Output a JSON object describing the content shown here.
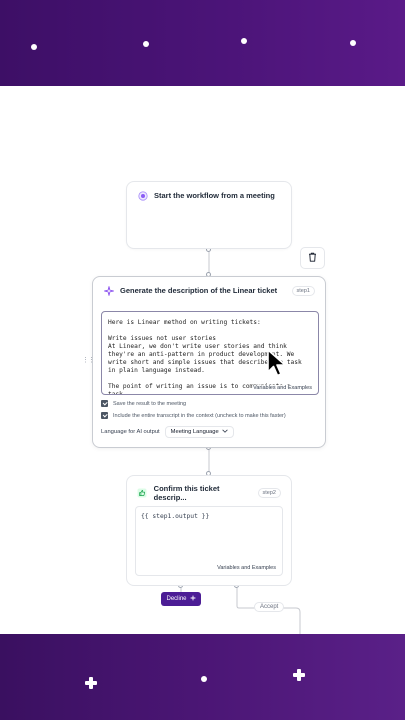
{
  "trigger": {
    "title": "Start the workflow from a meeting"
  },
  "generate": {
    "title": "Generate the description of the Linear ticket",
    "step": "step1",
    "prompt": "Here is Linear method on writing tickets:\n\nWrite issues not user stories\nAt Linear, we don't write user stories and think they're an anti-pattern in product development. We write short and simple issues that describe the task in plain language instead.\n\nThe point of writing an issue is to communicate a task.",
    "variables_link": "Variables and Examples",
    "save_result_label": "Save the result to the meeting",
    "include_transcript_label": "Include the entire transcript in the context (uncheck to make this faster)",
    "language_label": "Language for AI output",
    "language_value": "Meeting Language"
  },
  "confirm": {
    "title": "Confirm this ticket descrip...",
    "step": "step2",
    "code": "{{ step1.output }}",
    "variables_link": "Variables and Examples"
  },
  "actions": {
    "decline_label": "Decline",
    "accept_label": "Accept"
  },
  "icons": {
    "trigger": "target-icon",
    "generate": "sparkle-icon",
    "confirm": "thumbs-up-icon",
    "delete": "trash-icon",
    "cursor": "mouse-pointer-icon"
  },
  "colors": {
    "brand_purple": "#4b1478",
    "decline_button": "#4c1d95"
  }
}
